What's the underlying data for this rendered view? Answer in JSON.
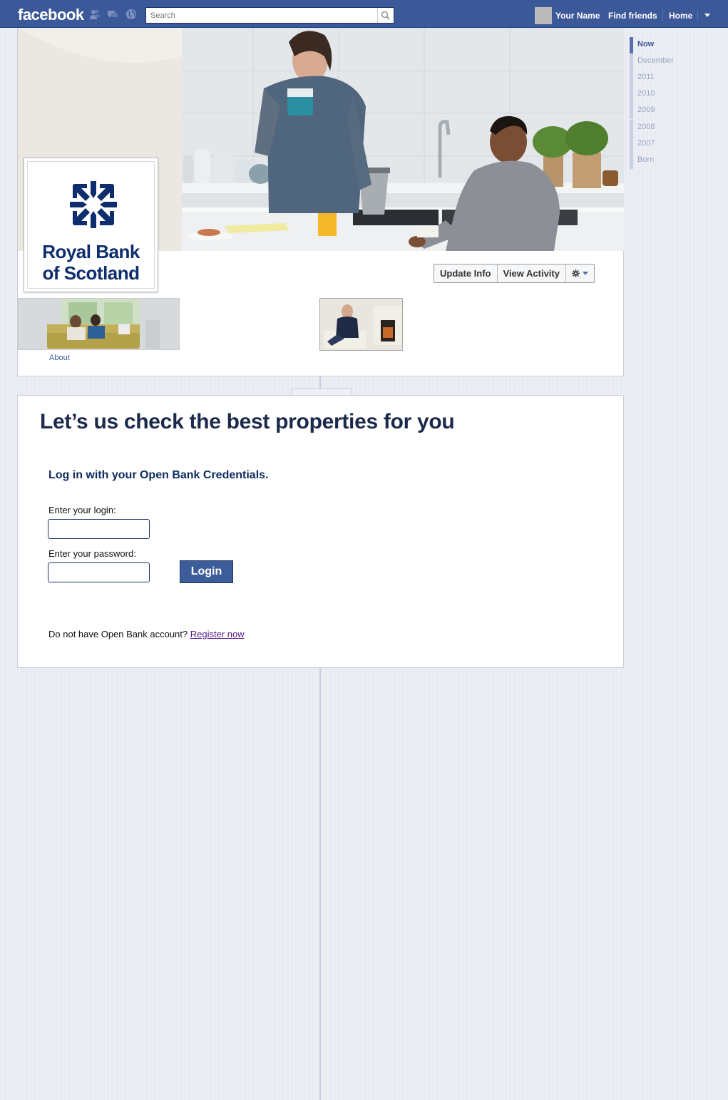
{
  "header": {
    "logo": "facebook",
    "search_placeholder": "Search",
    "user_name": "Your Name",
    "find_friends": "Find friends",
    "home": "Home"
  },
  "timeline_nav": [
    "Now",
    "December",
    "2011",
    "2010",
    "2009",
    "2008",
    "2007",
    "Born"
  ],
  "profile": {
    "brand_line1": "Royal Bank",
    "brand_line2": "of Scotland",
    "update_info": "Update Info",
    "view_activity": "View Activity",
    "about": "About"
  },
  "login": {
    "title": "Let’s us check the best properties for you",
    "subtitle": "Log in with your Open Bank Credentials.",
    "login_label": "Enter your login:",
    "password_label": "Enter your password:",
    "button": "Login",
    "register_text": "Do not have Open Bank account?",
    "register_link": "Register now"
  },
  "colors": {
    "facebook_blue": "#3b5998",
    "rbs_navy": "#0e2d6d",
    "login_button": "#3c5c9a"
  }
}
